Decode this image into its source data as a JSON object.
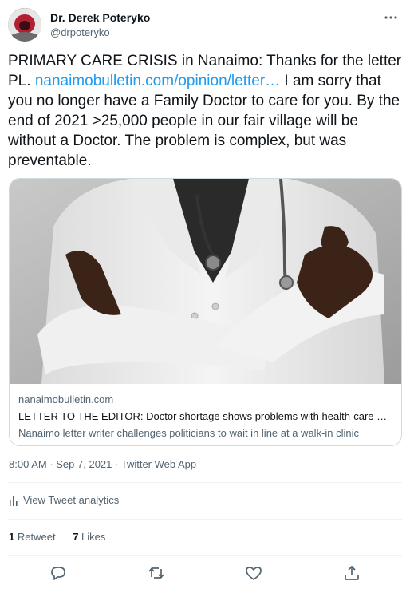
{
  "author": {
    "name": "Dr. Derek Poteryko",
    "handle": "@drpoteryko"
  },
  "tweet": {
    "text_before": "PRIMARY CARE CRISIS in Nanaimo: Thanks for the letter PL. ",
    "link_text": "nanaimobulletin.com/opinion/letter…",
    "text_after": "  I am sorry that you no longer have a Family Doctor to care for you. By the end of 2021 >25,000 people in our fair village will be without a Doctor. The problem is complex, but was preventable."
  },
  "card": {
    "domain": "nanaimobulletin.com",
    "title": "LETTER TO THE EDITOR: Doctor shortage shows problems with health-care sy…",
    "description": "Nanaimo letter writer challenges politicians to wait in line at a walk-in clinic"
  },
  "meta": {
    "time": "8:00 AM",
    "separator": " · ",
    "date": "Sep 7, 2021",
    "source": "Twitter Web App"
  },
  "analytics": {
    "label": "View Tweet analytics"
  },
  "stats": {
    "retweets_count": "1",
    "retweets_label": "Retweet",
    "likes_count": "7",
    "likes_label": "Likes"
  },
  "icons": {
    "more": "more-icon",
    "reply": "reply-icon",
    "retweet": "retweet-icon",
    "like": "like-icon",
    "share": "share-icon",
    "analytics": "analytics-icon"
  },
  "colors": {
    "link": "#1d9bf0",
    "secondary_text": "#536471",
    "primary_text": "#0f1419",
    "border": "#cfd9de"
  }
}
